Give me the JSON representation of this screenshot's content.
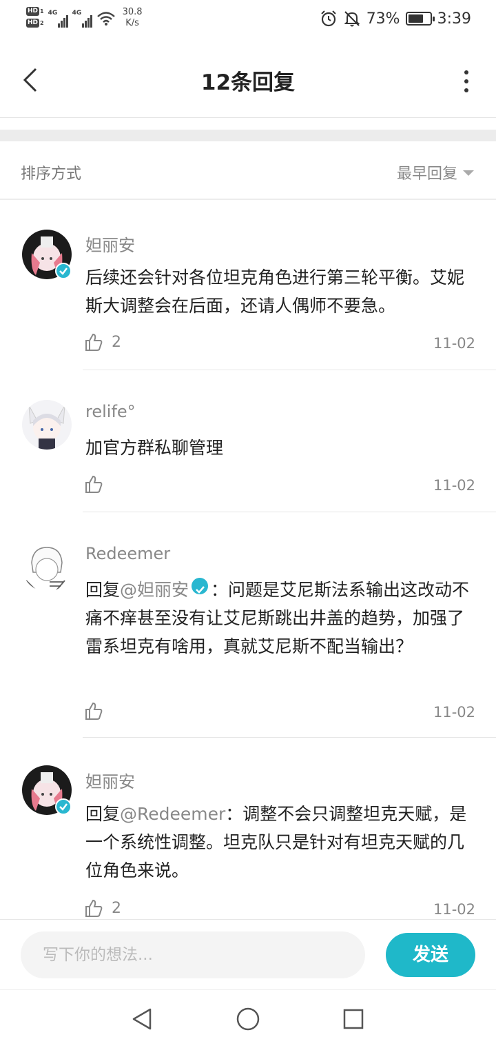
{
  "status_bar": {
    "hd1": "HD",
    "hd1_num": "1",
    "hd2": "HD",
    "hd2_num": "2",
    "net1": "4G",
    "net2": "4G",
    "speed_value": "30.8",
    "speed_unit": "K/s",
    "battery_percent": "73%",
    "battery_level": 0.73,
    "time": "3:39",
    "icons": [
      "alarm-icon",
      "mute-bell-icon",
      "battery-icon",
      "wifi-icon",
      "signal-icon"
    ]
  },
  "header": {
    "title": "12条回复",
    "back_icon": "chevron-left-icon",
    "more_icon": "more-vertical-icon"
  },
  "sort": {
    "label": "排序方式",
    "selected": "最早回复"
  },
  "comments": [
    {
      "username": "妲丽安",
      "verified": true,
      "text": "后续还会针对各位坦克角色进行第三轮平衡。艾妮斯大调整会在后面，还请人偶师不要急。",
      "likes": "2",
      "date": "11-02"
    },
    {
      "username": "relife°",
      "verified": false,
      "text": "加官方群私聊管理",
      "likes": "",
      "date": "11-02"
    },
    {
      "username": "Redeemer",
      "verified": false,
      "reply_prefix": "回复",
      "reply_to": "@妲丽安",
      "text": "：问题是艾尼斯法系输出这改动不痛不痒甚至没有让艾尼斯跳出井盖的趋势，加强了雷系坦克有啥用，真就艾尼斯不配当输出？",
      "likes": "",
      "date": "11-02"
    },
    {
      "username": "妲丽安",
      "verified": true,
      "reply_prefix": "回复",
      "reply_to": "@Redeemer",
      "text": "：调整不会只调整坦克天赋，是一个系统性调整。坦克队只是针对有坦克天赋的几位角色来说。",
      "likes": "2",
      "date": "11-02"
    }
  ],
  "input": {
    "placeholder": "写下你的想法...",
    "send_label": "发送"
  },
  "colors": {
    "accent": "#1fb8c9",
    "verified": "#29b7d0"
  }
}
